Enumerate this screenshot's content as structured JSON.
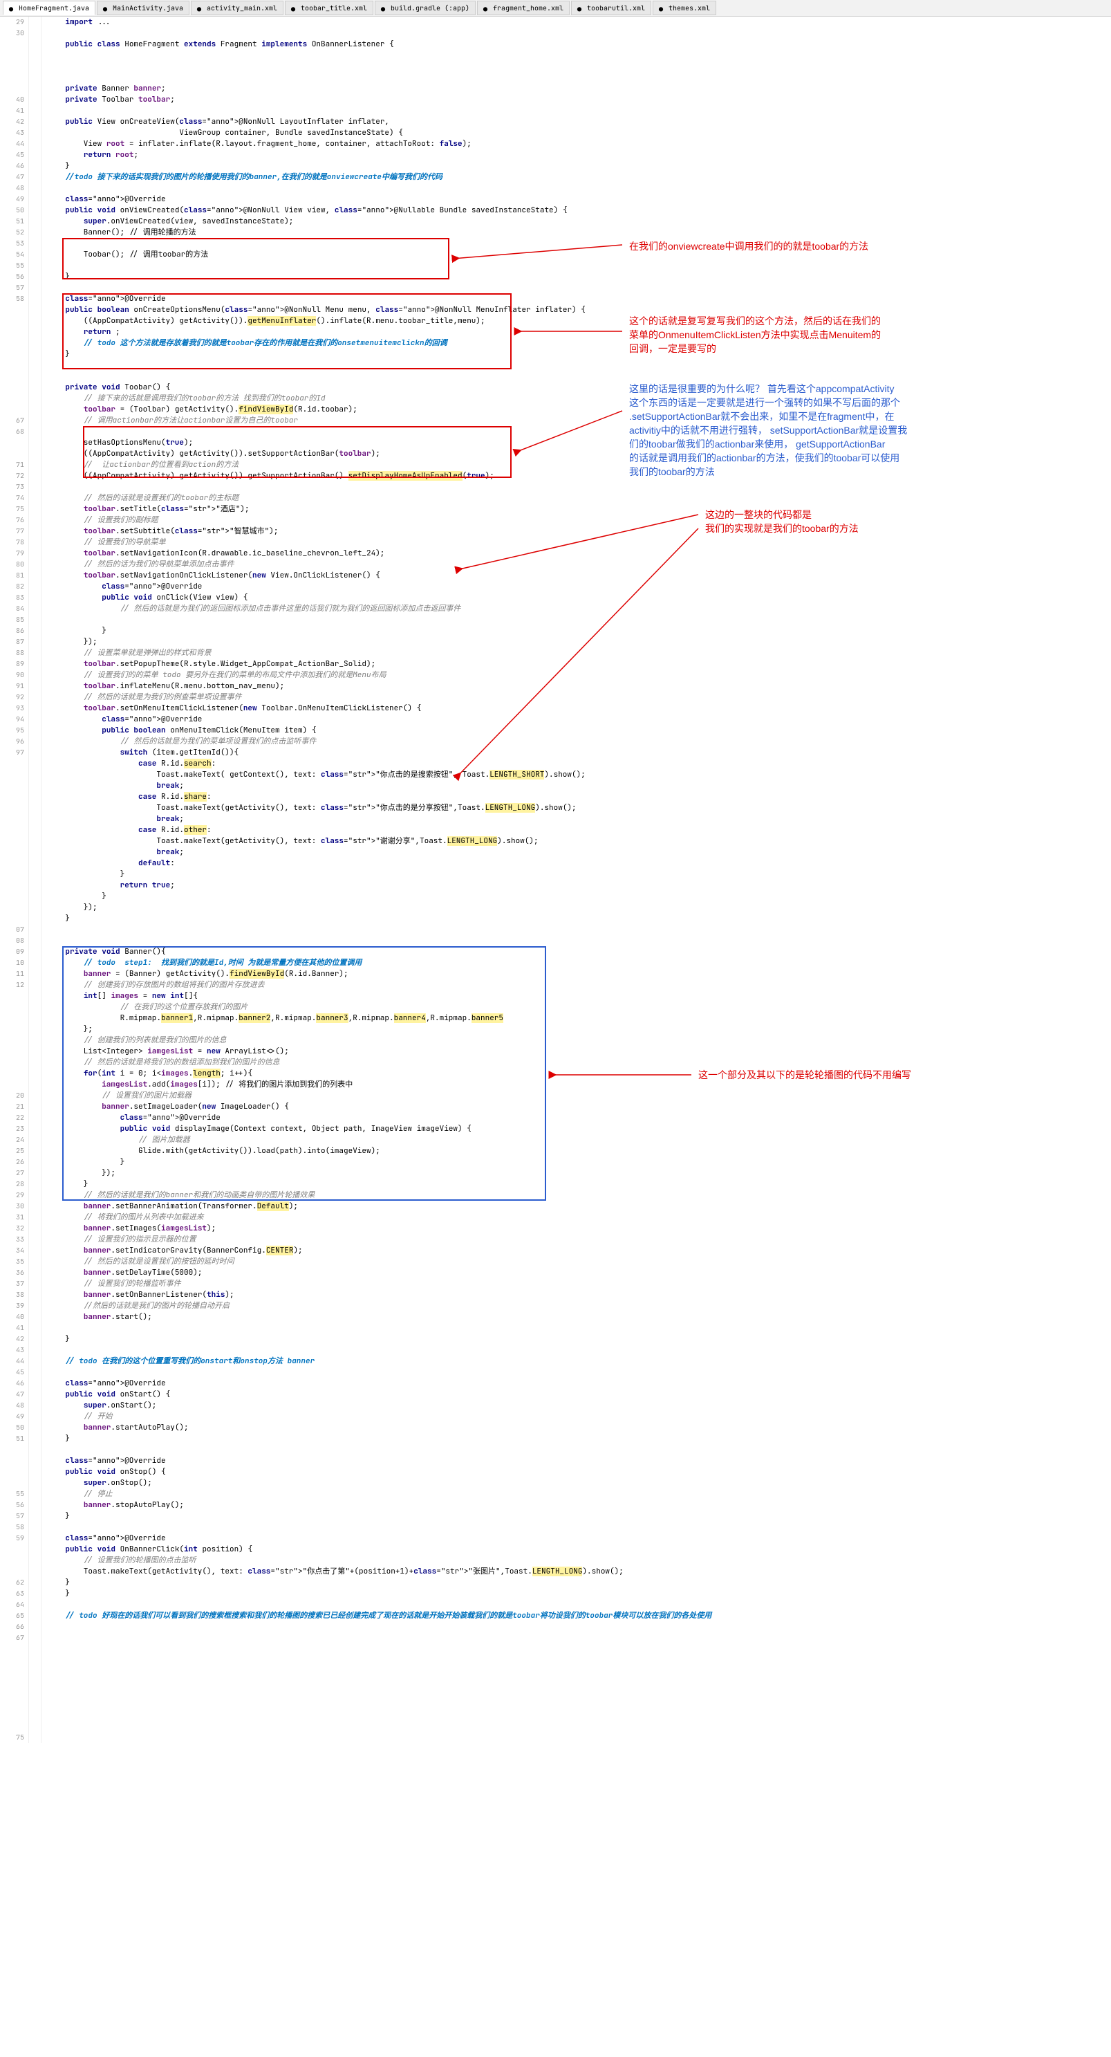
{
  "tabs": [
    {
      "label": "HomeFragment.java",
      "active": true,
      "icon": "java"
    },
    {
      "label": "MainActivity.java",
      "active": false,
      "icon": "java"
    },
    {
      "label": "activity_main.xml",
      "active": false,
      "icon": "xml"
    },
    {
      "label": "toobar_title.xml",
      "active": false,
      "icon": "xml"
    },
    {
      "label": "build.gradle (:app)",
      "active": false,
      "icon": "gradle"
    },
    {
      "label": "fragment_home.xml",
      "active": false,
      "icon": "xml"
    },
    {
      "label": "toobarutil.xml",
      "active": false,
      "icon": "xml"
    },
    {
      "label": "themes.xml",
      "active": false,
      "icon": "xml"
    }
  ],
  "gutter_lines": [
    "29",
    "30",
    "",
    "",
    "",
    "",
    "",
    "40",
    "41",
    "42",
    "43",
    "44",
    "45",
    "46",
    "47",
    "48",
    "49",
    "50",
    "51",
    "52",
    "53",
    "54",
    "55",
    "56",
    "57",
    "58",
    "",
    "",
    "",
    "",
    "",
    "",
    "",
    "",
    "",
    "",
    "67",
    "68",
    "",
    "",
    "71",
    "72",
    "73",
    "74",
    "75",
    "76",
    "77",
    "78",
    "79",
    "80",
    "81",
    "82",
    "83",
    "84",
    "85",
    "86",
    "87",
    "88",
    "89",
    "90",
    "91",
    "92",
    "93",
    "94",
    "95",
    "96",
    "97",
    "",
    "",
    "",
    "",
    "",
    "",
    "",
    "",
    "",
    "",
    "",
    "",
    "",
    "",
    "",
    "07",
    "08",
    "09",
    "10",
    "11",
    "12",
    "",
    "",
    "",
    "",
    "",
    "",
    "",
    "",
    "",
    "20",
    "21",
    "22",
    "23",
    "24",
    "25",
    "26",
    "27",
    "28",
    "29",
    "30",
    "31",
    "32",
    "33",
    "34",
    "35",
    "36",
    "37",
    "38",
    "39",
    "40",
    "41",
    "42",
    "43",
    "44",
    "45",
    "46",
    "47",
    "48",
    "49",
    "50",
    "51",
    "",
    "",
    "",
    "",
    "55",
    "56",
    "57",
    "58",
    "59",
    "",
    "",
    "",
    "62",
    "63",
    "64",
    "65",
    "66",
    "67",
    "",
    "",
    "",
    "",
    "",
    "",
    "",
    "",
    "75"
  ],
  "code": {
    "l1": "import ...",
    "l3": "public class HomeFragment extends Fragment implements OnBannerListener {",
    "l7": "private Banner banner;",
    "l8": "private Toolbar toolbar;",
    "l10": "public View onCreateView(@NonNull LayoutInflater inflater,",
    "l11": "                         ViewGroup container, Bundle savedInstanceState) {",
    "l12": "    View root = inflater.inflate(R.layout.fragment_home, container, attachToRoot: false);",
    "l13": "    return root;",
    "l14": "}",
    "l15": "//todo 接下来的话实现我们的图片的轮播使用我们的banner,在我们的就是onviewcreate中编写我们的代码",
    "l17": "@Override",
    "l18": "public void onViewCreated(@NonNull View view, @Nullable Bundle savedInstanceState) {",
    "l19": "    super.onViewCreated(view, savedInstanceState);",
    "l20": "    Banner(); // 调用轮播的方法",
    "l22": "    Toobar(); // 调用toobar的方法",
    "l24": "}",
    "l26": "@Override",
    "l27": "public boolean onCreateOptionsMenu(@NonNull Menu menu, @NonNull MenuInflater inflater) {",
    "l28": "    ((AppCompatActivity) getActivity()).getMenuInflater().inflate(R.menu.toobar_title,menu);",
    "l29": "    return ;",
    "l30": "    // todo 这个方法就是存放着我们的就是toobar存在的作用就是在我们的onsetmenuitemclickn的回调",
    "l31": "}",
    "l34": "private void Toobar() {",
    "l35": "    // 接下来的话就是调用我们的toobar的方法 找到我们的toobar的Id",
    "l36": "    toolbar = (Toolbar) getActivity().findViewById(R.id.toobar);",
    "l37": "    // 调用actionbar的方法让actionbar设置为自己的toobar",
    "l39": "    setHasOptionsMenu(true);",
    "l40": "    ((AppCompatActivity) getActivity()).setSupportActionBar(toolbar);",
    "l41": "    //  让actionbar的位置看到action的方法",
    "l42": "    ((AppCompatActivity) getActivity()).getSupportActionBar().setDisplayHomeAsUpEnabled(true);",
    "l44": "    // 然后的话就是设置我们的toobar的主标题",
    "l45": "    toolbar.setTitle(\"酒店\");",
    "l46": "    // 设置我们的副标题",
    "l47": "    toolbar.setSubtitle(\"智慧城市\");",
    "l48": "    // 设置我们的导航菜单",
    "l49": "    toolbar.setNavigationIcon(R.drawable.ic_baseline_chevron_left_24);",
    "l50": "    // 然后的话为我们的导航菜单添加点击事件",
    "l51": "    toolbar.setNavigationOnClickListener(new View.OnClickListener() {",
    "l52": "        @Override",
    "l53": "        public void onClick(View view) {",
    "l54": "            // 然后的话就是为我们的返回图标添加点击事件这里的话我们就为我们的返回图标添加点击返回事件",
    "l56": "        }",
    "l57": "    });",
    "l58": "    // 设置菜单就是弹弹出的样式和背景",
    "l59": "    toolbar.setPopupTheme(R.style.Widget_AppCompat_ActionBar_Solid);",
    "l60": "    // 设置我们的的菜单 todo 要另外在我们的菜单的布局文件中添加我们的就是Menu布局",
    "l61": "    toolbar.inflateMenu(R.menu.bottom_nav_menu);",
    "l62": "    // 然后的话就是为我们的例查菜单项设置事件",
    "l63": "    toolbar.setOnMenuItemClickListener(new Toolbar.OnMenuItemClickListener() {",
    "l64": "        @Override",
    "l65": "        public boolean onMenuItemClick(MenuItem item) {",
    "l66": "            // 然后的话就是为我们的菜单项设置我们的点击监听事件",
    "l67": "            switch (item.getItemId()){",
    "l68": "                case R.id.search:",
    "l69": "                    Toast.makeText( getContext(), text: \"你点击的是搜索按钮\", Toast.LENGTH_SHORT).show();",
    "l70": "                    break;",
    "l71": "                case R.id.share:",
    "l72": "                    Toast.makeText(getActivity(), text: \"你点击的是分享按钮\",Toast.LENGTH_LONG).show();",
    "l73": "                    break;",
    "l74": "                case R.id.other:",
    "l75": "                    Toast.makeText(getActivity(), text: \"谢谢分享\",Toast.LENGTH_LONG).show();",
    "l76": "                    break;",
    "l77": "                default:",
    "l78": "            }",
    "l79": "            return true;",
    "l80": "        }",
    "l81": "    });",
    "l82": "}",
    "l85": "private void Banner(){",
    "l86": "    // todo  step1:  找到我们的就是Id,时间 为就是常量方便在其他的位置调用",
    "l87": "    banner = (Banner) getActivity().findViewById(R.id.Banner);",
    "l88": "    // 创建我们的存放图片的数组将我们的图片存放进去",
    "l89": "    int[] images = new int[]{",
    "l90": "            // 在我们的这个位置存放我们的图片",
    "l91": "            R.mipmap.banner1,R.mipmap.banner2,R.mipmap.banner3,R.mipmap.banner4,R.mipmap.banner5",
    "l92": "    };",
    "l93": "    // 创建我们的列表就是我们的图片的信息",
    "l94": "    List<Integer> iamgesList = new ArrayList<>();",
    "l95": "    // 然后的话就是将我们的的数组添加到我们的图片的信息",
    "l96": "    for(int i = 0; i<images.length; i++){",
    "l97": "        iamgesList.add(images[i]); // 将我们的图片添加到我们的列表中",
    "l98": "        // 设置我们的图片加载器",
    "l99": "        banner.setImageLoader(new ImageLoader() {",
    "l100": "            @Override",
    "l101": "            public void displayImage(Context context, Object path, ImageView imageView) {",
    "l102": "                // 图片加载器",
    "l103": "                Glide.with(getActivity()).load(path).into(imageView);",
    "l104": "            }",
    "l105": "        });",
    "l106": "    }",
    "l107": "    // 然后的话就是我们的banner和我们的动画类自带的图片轮播效果",
    "l108": "    banner.setBannerAnimation(Transformer.Default);",
    "l109": "    // 将我们的图片从列表中加载进来",
    "l110": "    banner.setImages(iamgesList);",
    "l111": "    // 设置我们的指示显示器的位置",
    "l112": "    banner.setIndicatorGravity(BannerConfig.CENTER);",
    "l113": "    // 然后的话就是设置我们的按钮的延时时间",
    "l114": "    banner.setDelayTime(5000);",
    "l115": "    // 设置我们的轮播监听事件",
    "l116": "    banner.setOnBannerListener(this);",
    "l117": "    //然后的话就是我们的图片的轮播自动开启",
    "l118": "    banner.start();",
    "l120": "}",
    "l122": "// todo 在我们的这个位置重写我们的onstart和onstop方法 banner",
    "l124": "@Override",
    "l125": "public void onStart() {",
    "l126": "    super.onStart();",
    "l127": "    // 开始",
    "l128": "    banner.startAutoPlay();",
    "l129": "}",
    "l131": "@Override",
    "l132": "public void onStop() {",
    "l133": "    super.onStop();",
    "l134": "    // 停止",
    "l135": "    banner.stopAutoPlay();",
    "l136": "}",
    "l138": "@Override",
    "l139": "public void OnBannerClick(int position) {",
    "l140": "    // 设置我们的轮播图的点击监听",
    "l141": "    Toast.makeText(getActivity(), text: \"你点击了第\"+(position+1)+\"张图片\",Toast.LENGTH_LONG).show();",
    "l142": "}",
    "l143": "}",
    "l145": "// todo 好现在的话我们可以看到我们的搜索框搜索和我们的轮播图的搜索已已经创建完成了现在的话就是开始开始装载我们的就是toobar将功设我们的toobar模块可以放在我们的各处使用"
  },
  "annotations": {
    "a1": "在我们的onviewcreate中调用我们的的就是toobar的方法",
    "a2_line1": "这个的话就是复写复写我们的这个方法，然后的话在我们的",
    "a2_line2": "菜单的OnmenuItemClickListen方法中实现点击Menuitem的",
    "a2_line3": "回调，一定是要写的",
    "a3_line1": "这里的话是很重要的为什么呢？ 首先看这个appcompatActivity",
    "a3_line2": "这个东西的话是一定要就是进行一个强转的如果不写后面的那个",
    "a3_line3": ".setSupportActionBar就不会出来，如里不是在fragment中，在",
    "a3_line4": "activitiy中的话就不用进行强转， setSupportActionBar就是设置我",
    "a3_line5": "们的toobar做我们的actionbar来使用， getSupportActionBar",
    "a3_line6": "的话就是调用我们的actionbar的方法，使我们的toobar可以使用",
    "a3_line7": "我们的toobar的方法",
    "a4_line1": "这边的一整块的代码都是",
    "a4_line2": "我们的实现就是我们的toobar的方法",
    "a5": "这一个部分及其以下的是轮轮播图的代码不用编写"
  }
}
